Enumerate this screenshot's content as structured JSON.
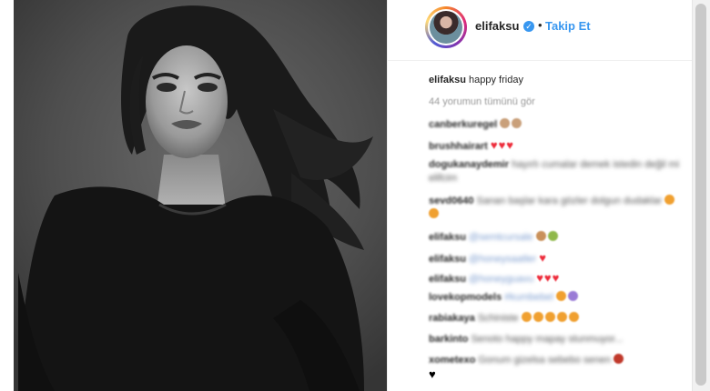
{
  "post": {
    "username": "elifaksu",
    "follow_label": "Takip Et",
    "separator": "•",
    "verified_glyph": "✓",
    "caption_user": "elifaksu",
    "caption_text": "happy friday",
    "view_all": "44 yorumun tümünü gör"
  },
  "comments": [
    {
      "user": "canberkuregel",
      "text": "",
      "emoji": [
        "#c9a07a",
        "#c9a07a"
      ]
    },
    {
      "user": "brushhairart",
      "text": "",
      "hearts": 3
    },
    {
      "user": "dogukanaydemir",
      "text": "hayırlı cumalar demek istedin değil mi elifcim",
      "blurred": true
    },
    {
      "user": "sevd0640",
      "text": "Sanan başlar kara gözler dolgun dudaklar",
      "emoji": [
        "#f0a030",
        "#f0a030"
      ],
      "blurred": true
    },
    {
      "user": "elifaksu",
      "text": "@semtcursale",
      "emoji": [
        "#c9905a",
        "#8fb84a"
      ],
      "blurred": true
    },
    {
      "user": "elifaksu",
      "text": "@honeysaatler",
      "hearts": 1,
      "blurred": true
    },
    {
      "user": "elifaksu",
      "text": "@honeyguavu",
      "hearts": 3,
      "blurred": true
    },
    {
      "user": "lovekopmodels",
      "text": "#kumbebel",
      "emoji": [
        "#f0a030",
        "#9a7bd6"
      ],
      "blurred": true
    },
    {
      "user": "rabiakaya",
      "text": "Schiniste",
      "emoji": [
        "#f0a030",
        "#f0a030",
        "#f0a030",
        "#f0a030",
        "#f0a030"
      ],
      "blurred": true
    },
    {
      "user": "barkinto",
      "text": "Senoto happy mapay stunmuyor...",
      "blurred": true
    },
    {
      "user": "xometexo",
      "text": "Gonum gizelsa sebebo senen",
      "rose": true,
      "black_heart": "♥",
      "blurred": true
    }
  ]
}
